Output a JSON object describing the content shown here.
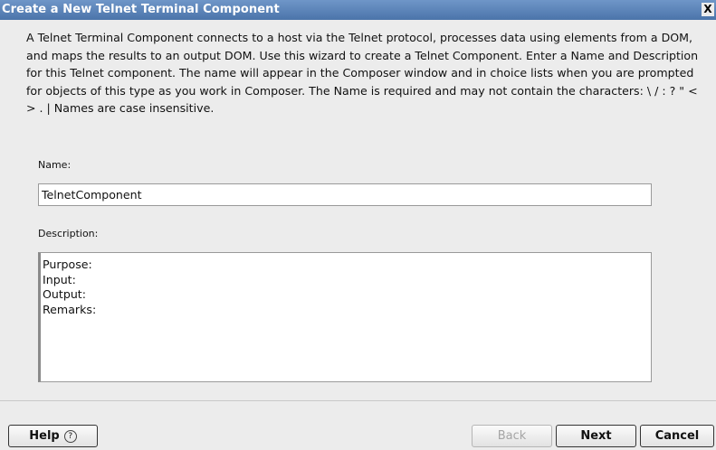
{
  "window": {
    "title": "Create a New Telnet Terminal Component",
    "close_label": "X"
  },
  "intro": {
    "text": "A Telnet Terminal Component connects to a host via the Telnet protocol, processes data using elements from a DOM, and maps the results to an output DOM.  Use this wizard to create a Telnet Component.  Enter a Name and Description for this Telnet component.  The name will appear in the Composer window and in choice lists when you are prompted for objects of this type as you work in Composer.  The Name is required and may not contain the characters: \\ / : ? \" < > . |  Names are case insensitive."
  },
  "name_field": {
    "label": "Name:",
    "value": "TelnetComponent"
  },
  "description_field": {
    "label": "Description:",
    "lines": [
      "Purpose:",
      "Input:",
      "Output:",
      "Remarks:"
    ]
  },
  "buttons": {
    "help": "Help",
    "help_icon": "?",
    "back": "Back",
    "next": "Next",
    "cancel": "Cancel"
  }
}
